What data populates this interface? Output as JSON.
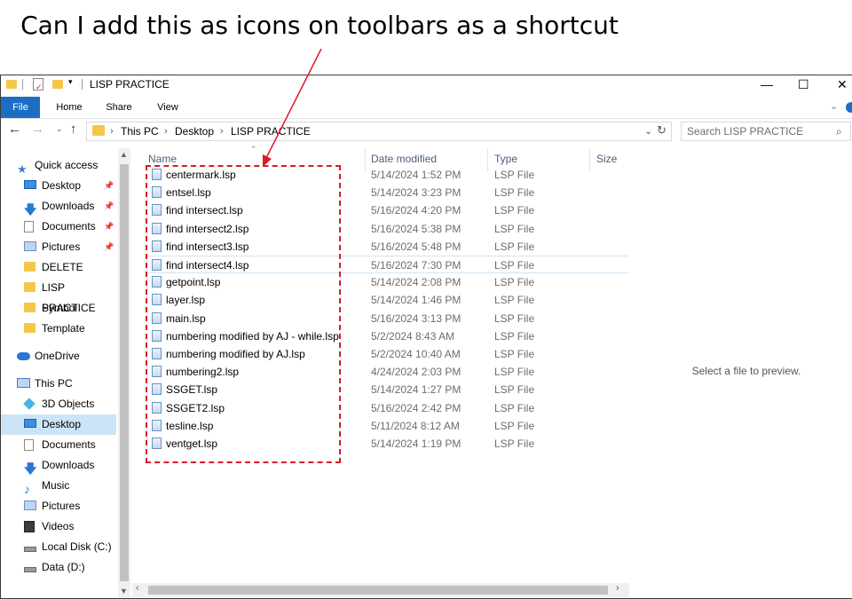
{
  "question": "Can I add this as icons on toolbars as a shortcut",
  "window": {
    "title": "LISP PRACTICE",
    "controls": {
      "minimize": "—",
      "maximize": "☐",
      "close": "✕"
    }
  },
  "ribbon": {
    "tabs": [
      {
        "label": "File"
      },
      {
        "label": "Home"
      },
      {
        "label": "Share"
      },
      {
        "label": "View"
      }
    ]
  },
  "address": {
    "crumbs": [
      "This PC",
      "Desktop",
      "LISP PRACTICE"
    ],
    "search_placeholder": "Search LISP PRACTICE"
  },
  "nav": {
    "items": [
      {
        "label": "Quick access",
        "icon": "star-icon"
      },
      {
        "label": "Desktop",
        "icon": "desktop-icon",
        "pinned": true
      },
      {
        "label": "Downloads",
        "icon": "download-icon",
        "pinned": true
      },
      {
        "label": "Documents",
        "icon": "document-icon",
        "pinned": true
      },
      {
        "label": "Pictures",
        "icon": "pictures-icon",
        "pinned": true
      },
      {
        "label": "DELETE",
        "icon": "folder-icon"
      },
      {
        "label": "LISP PRACTICE",
        "icon": "folder-icon"
      },
      {
        "label": "Symbol",
        "icon": "folder-icon"
      },
      {
        "label": "Template",
        "icon": "folder-icon"
      },
      {
        "label": "OneDrive",
        "icon": "cloud-icon"
      },
      {
        "label": "This PC",
        "icon": "computer-icon"
      },
      {
        "label": "3D Objects",
        "icon": "cube-icon"
      },
      {
        "label": "Desktop",
        "icon": "desktop-icon",
        "selected": true
      },
      {
        "label": "Documents",
        "icon": "document-icon"
      },
      {
        "label": "Downloads",
        "icon": "download-icon"
      },
      {
        "label": "Music",
        "icon": "music-icon"
      },
      {
        "label": "Pictures",
        "icon": "pictures-icon"
      },
      {
        "label": "Videos",
        "icon": "video-icon"
      },
      {
        "label": "Local Disk (C:)",
        "icon": "disk-icon"
      },
      {
        "label": "Data (D:)",
        "icon": "disk-icon"
      }
    ]
  },
  "columns": {
    "name": "Name",
    "date": "Date modified",
    "type": "Type",
    "size": "Size"
  },
  "files": [
    {
      "name": "centermark.lsp",
      "date": "5/14/2024 1:52 PM",
      "type": "LSP File"
    },
    {
      "name": "entsel.lsp",
      "date": "5/14/2024 3:23 PM",
      "type": "LSP File"
    },
    {
      "name": "find intersect.lsp",
      "date": "5/16/2024 4:20 PM",
      "type": "LSP File"
    },
    {
      "name": "find intersect2.lsp",
      "date": "5/16/2024 5:38 PM",
      "type": "LSP File"
    },
    {
      "name": "find intersect3.lsp",
      "date": "5/16/2024 5:48 PM",
      "type": "LSP File"
    },
    {
      "name": "find intersect4.lsp",
      "date": "5/16/2024 7:30 PM",
      "type": "LSP File",
      "selected": true
    },
    {
      "name": "getpoint.lsp",
      "date": "5/14/2024 2:08 PM",
      "type": "LSP File"
    },
    {
      "name": "layer.lsp",
      "date": "5/14/2024 1:46 PM",
      "type": "LSP File"
    },
    {
      "name": "main.lsp",
      "date": "5/16/2024 3:13 PM",
      "type": "LSP File"
    },
    {
      "name": "numbering modified by AJ - while.lsp",
      "date": "5/2/2024 8:43 AM",
      "type": "LSP File"
    },
    {
      "name": "numbering modified by AJ.lsp",
      "date": "5/2/2024 10:40 AM",
      "type": "LSP File"
    },
    {
      "name": "numbering2.lsp",
      "date": "4/24/2024 2:03 PM",
      "type": "LSP File"
    },
    {
      "name": "SSGET.lsp",
      "date": "5/14/2024 1:27 PM",
      "type": "LSP File"
    },
    {
      "name": "SSGET2.lsp",
      "date": "5/16/2024 2:42 PM",
      "type": "LSP File"
    },
    {
      "name": "tesline.lsp",
      "date": "5/11/2024 8:12 AM",
      "type": "LSP File"
    },
    {
      "name": "ventget.lsp",
      "date": "5/14/2024 1:19 PM",
      "type": "LSP File"
    }
  ],
  "preview": {
    "text": "Select a file to preview."
  },
  "colors": {
    "accent": "#1a6fc4",
    "annotation": "#d81b25",
    "folder": "#f5c64a"
  }
}
